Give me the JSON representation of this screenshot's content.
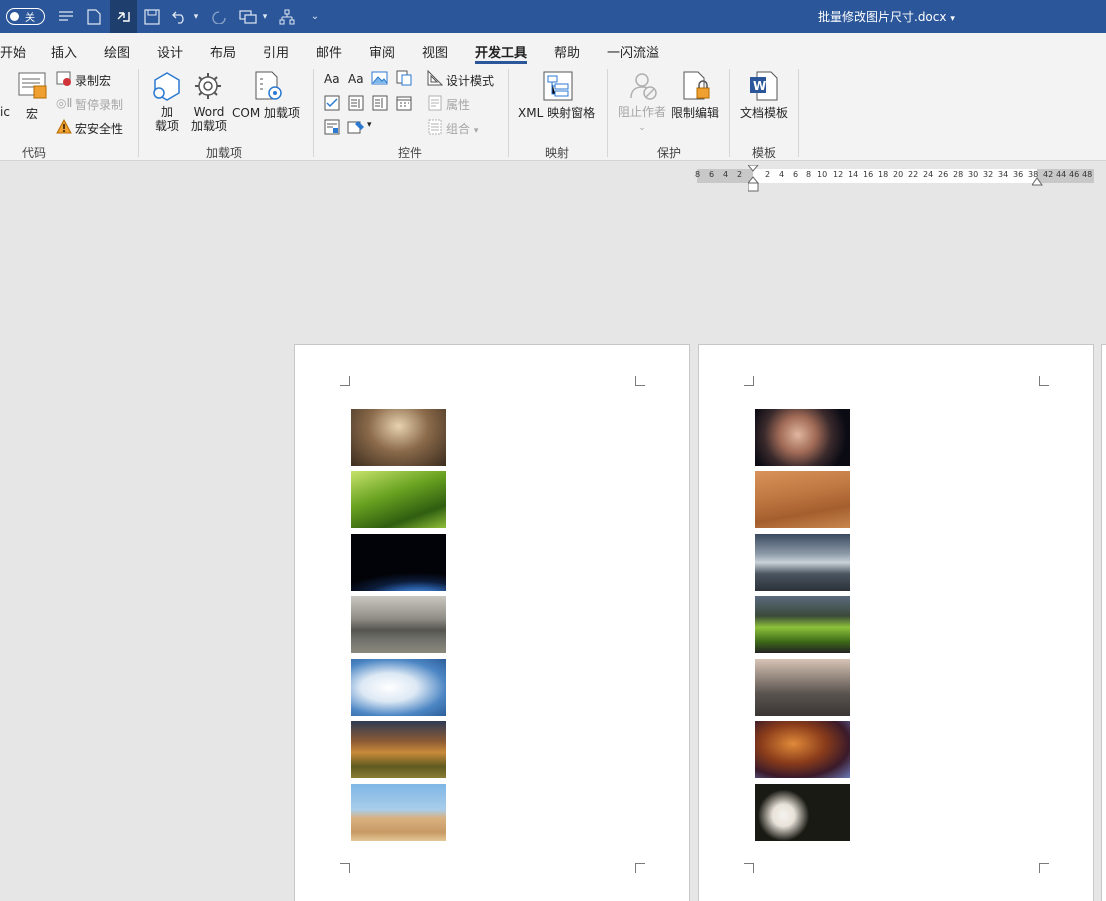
{
  "titlebar": {
    "toggle_label": "关",
    "doc_title": "批量修改图片尺寸.docx",
    "title_caret": "▾"
  },
  "tabs": [
    "开始",
    "插入",
    "绘图",
    "设计",
    "布局",
    "引用",
    "邮件",
    "审阅",
    "视图",
    "开发工具",
    "帮助",
    "一闪流溢"
  ],
  "active_tab": "开发工具",
  "ribbon": {
    "code": {
      "group_label": "代码",
      "vb_partial": "ic",
      "macro_label": "宏",
      "record_macro": "录制宏",
      "pause_record": "暂停录制",
      "macro_security": "宏安全性"
    },
    "addins": {
      "group_label": "加载项",
      "addin_line1": "加",
      "addin_line2": "载项",
      "word_line1": "Word",
      "word_line2": "加载项",
      "com_label": "COM 加载项"
    },
    "controls": {
      "group_label": "控件",
      "aa1": "Aa",
      "aa2": "Aa",
      "design_mode": "设计模式",
      "properties": "属性",
      "group": "组合"
    },
    "mapping": {
      "group_label": "映射",
      "xml_pane": "XML 映射窗格"
    },
    "protect": {
      "group_label": "保护",
      "block_authors": "阻止作者",
      "restrict_editing": "限制编辑"
    },
    "templates": {
      "group_label": "模板",
      "doc_template": "文档模板"
    }
  },
  "ruler": {
    "left_numbers": [
      "8",
      "6",
      "4",
      "2"
    ],
    "mid_numbers": [
      "2",
      "4",
      "6",
      "8",
      "10",
      "12",
      "14",
      "16",
      "18",
      "20",
      "22",
      "24",
      "26",
      "28",
      "30",
      "32",
      "34",
      "36",
      "38"
    ],
    "right_numbers": [
      "42",
      "44",
      "46",
      "48"
    ]
  },
  "pages": [
    {
      "images": [
        "radial-burst-photo",
        "green-leaves-photo",
        "earth-from-space-photo",
        "city-skyline-photo",
        "clouds-sky-photo",
        "storm-over-field-photo",
        "pyramids-photo"
      ]
    },
    {
      "images": [
        "planet-space-photo",
        "sand-dunes-photo",
        "pier-storm-photo",
        "green-creature-photo",
        "city-aerial-photo",
        "nebula-photo",
        "white-flowers-photo"
      ]
    }
  ],
  "colors": {
    "titlebar": "#2b579a",
    "ribbon_bg": "#f3f3f3",
    "canvas_bg": "#e6e6e6",
    "page_bg": "#ffffff"
  }
}
